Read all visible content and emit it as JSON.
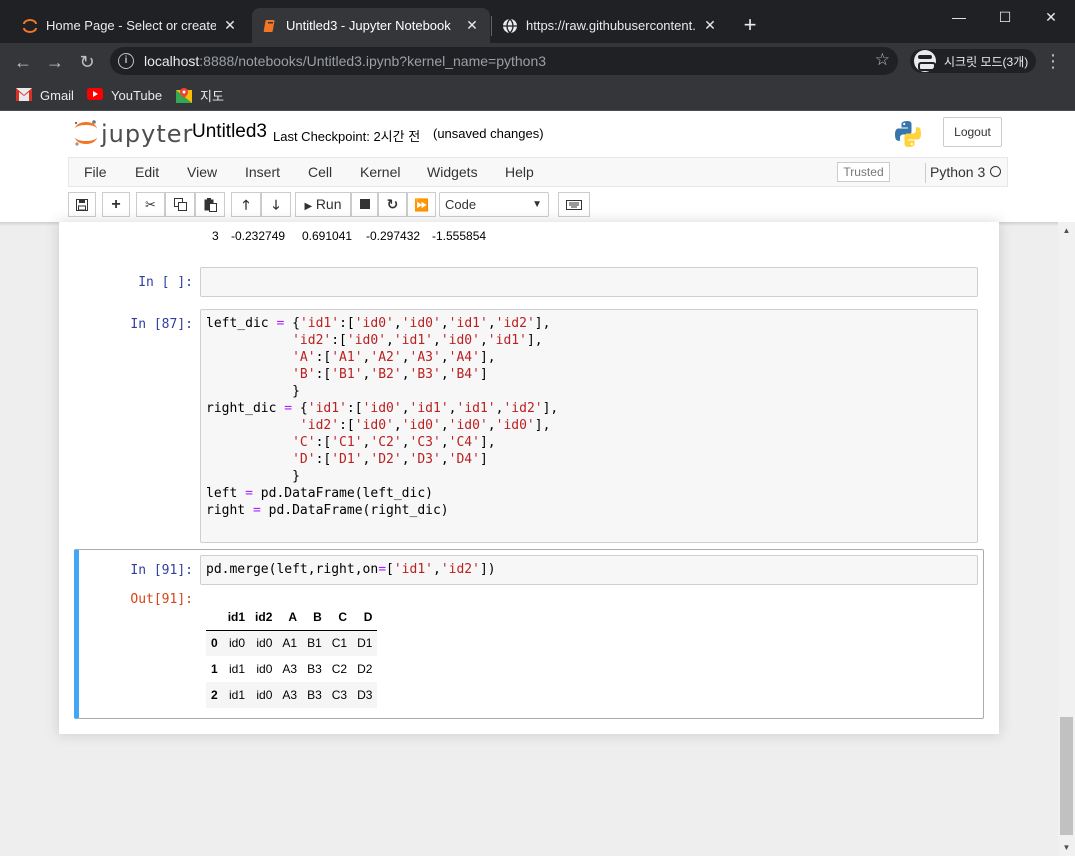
{
  "browser": {
    "tabs": [
      {
        "title": "Home Page - Select or create a notebook",
        "active": false
      },
      {
        "title": "Untitled3 - Jupyter Notebook",
        "active": true
      },
      {
        "title": "https://raw.githubusercontent.com",
        "active": false
      }
    ],
    "close_glyph": "✕",
    "new_tab_glyph": "+",
    "window_controls": {
      "minimize": "—",
      "maximize": "☐",
      "close": "✕"
    },
    "url_host": "localhost",
    "url_rest": ":8888/notebooks/Untitled3.ipynb?kernel_name=python3",
    "incognito_label": "시크릿 모드(3개)",
    "bookmarks": [
      "Gmail",
      "YouTube",
      "지도"
    ]
  },
  "jupyter": {
    "logo_text": "jupyter",
    "notebook_name": "Untitled3",
    "checkpoint": "Last Checkpoint: 2시간 전",
    "autosave_status": "(unsaved changes)",
    "logout_label": "Logout",
    "menu": [
      "File",
      "Edit",
      "View",
      "Insert",
      "Cell",
      "Kernel",
      "Widgets",
      "Help"
    ],
    "trusted_label": "Trusted",
    "kernel_name": "Python 3",
    "toolbar": {
      "run_label": "Run",
      "cell_type": "Code"
    }
  },
  "notebook": {
    "previous_output_row": {
      "index": "3",
      "values": [
        "-0.232749",
        "0.691041",
        "-0.297432",
        "-1.555854"
      ]
    },
    "cells": [
      {
        "prompt": "In [ ]:",
        "code": ""
      },
      {
        "prompt": "In [87]:"
      },
      {
        "prompt": "In [91]:",
        "out_prompt": "Out[91]:"
      }
    ],
    "output_table": {
      "columns": [
        "",
        "id1",
        "id2",
        "A",
        "B",
        "C",
        "D"
      ],
      "rows": [
        [
          "0",
          "id0",
          "id0",
          "A1",
          "B1",
          "C1",
          "D1"
        ],
        [
          "1",
          "id1",
          "id0",
          "A3",
          "B3",
          "C2",
          "D2"
        ],
        [
          "2",
          "id1",
          "id0",
          "A3",
          "B3",
          "C3",
          "D3"
        ]
      ]
    }
  }
}
